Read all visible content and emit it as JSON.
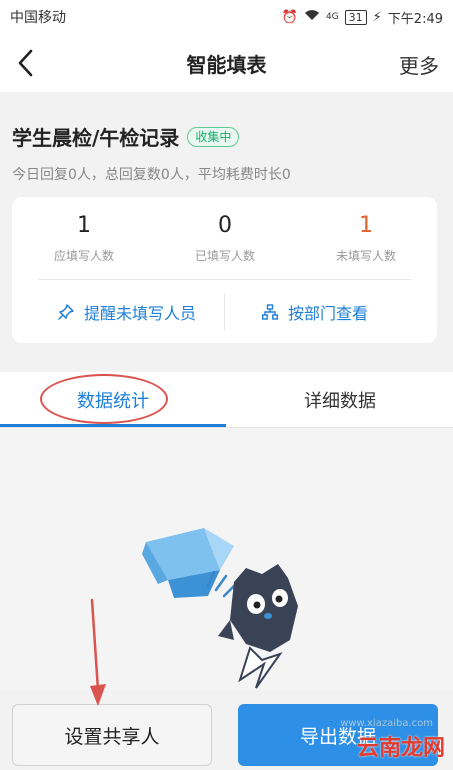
{
  "status_bar": {
    "carrier": "中国移动",
    "network": "4G",
    "battery": "31",
    "time": "下午2:49"
  },
  "nav": {
    "title": "智能填表",
    "more_label": "更多",
    "back_icon": "chevron-left-icon"
  },
  "form": {
    "title": "学生晨检/午检记录",
    "status_badge": "收集中",
    "summary": "今日回复0人，总回复数0人，平均耗费时长0"
  },
  "stats": [
    {
      "value": "1",
      "label": "应填写人数"
    },
    {
      "value": "0",
      "label": "已填写人数"
    },
    {
      "value": "1",
      "label": "未填写人数"
    }
  ],
  "actions": {
    "remind_label": "提醒未填写人员",
    "remind_icon": "pin-icon",
    "by_department_label": "按部门查看",
    "by_department_icon": "org-chart-icon"
  },
  "tabs": {
    "active": "数据统计",
    "inactive": "详细数据"
  },
  "footer": {
    "share_label": "设置共享人",
    "export_label": "导出数据"
  },
  "watermark": {
    "text": "云南龙网",
    "sub": "www.xiazaiba.com"
  },
  "colors": {
    "accent": "#1e7fd9",
    "export_button": "#2d8fe5",
    "badge_green": "#1aad6b",
    "unfilled_count": "#e0622f",
    "annotation_red": "#d9534f"
  }
}
